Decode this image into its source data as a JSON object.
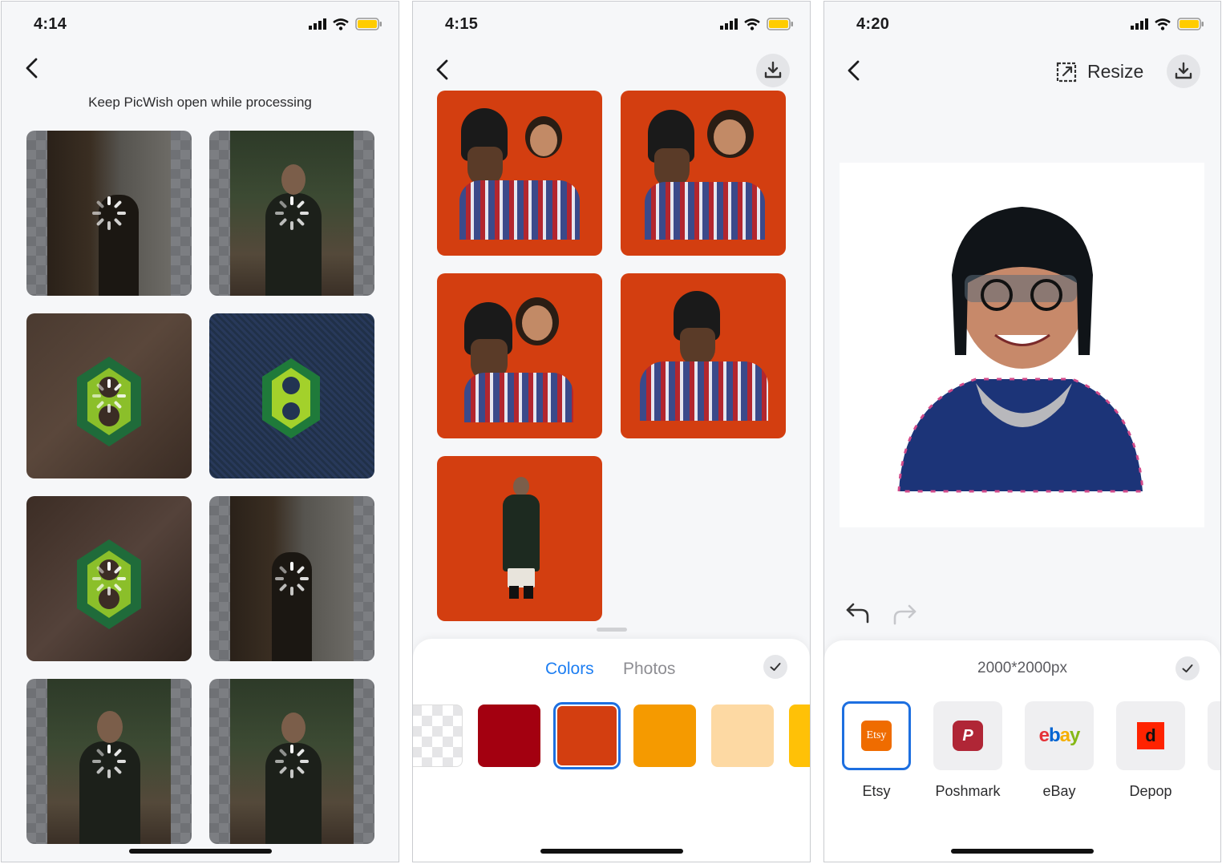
{
  "screens": [
    {
      "time": "4:14",
      "note": "Keep PicWish open while processing"
    },
    {
      "time": "4:15",
      "tabs": {
        "colors": "Colors",
        "photos": "Photos"
      },
      "swatches": [
        "transparent",
        "#a30010",
        "#d33e10",
        "#f59a00",
        "#fdd9a3",
        "#ffc107"
      ],
      "selected_swatch": "#d33e10"
    },
    {
      "time": "4:20",
      "resize_label": "Resize",
      "size": "2000*2000px",
      "platforms": [
        {
          "label": "Etsy",
          "logo": "Etsy",
          "color": "#ef6c00"
        },
        {
          "label": "Poshmark",
          "logo": "P",
          "color": "#b02636"
        },
        {
          "label": "eBay",
          "logo": "ebay",
          "color": "#e53238"
        },
        {
          "label": "Depop",
          "logo": "d",
          "color": "#ff2300"
        }
      ]
    }
  ],
  "colors": {
    "accent": "#1d7ef2",
    "tile_background": "#d33e10",
    "battery": "#ffcc00"
  }
}
